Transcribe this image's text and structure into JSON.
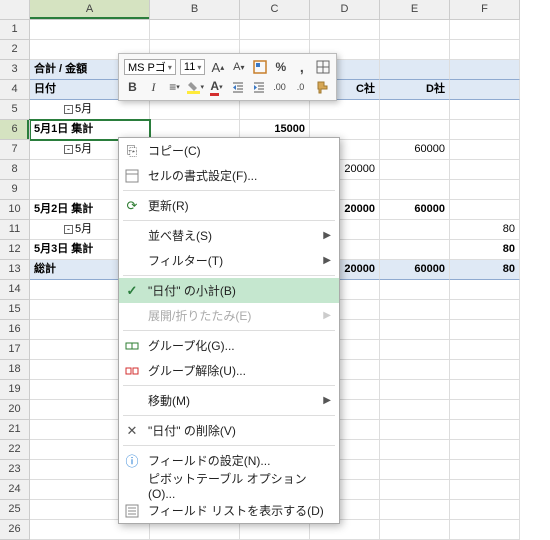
{
  "columns": [
    "A",
    "B",
    "C",
    "D",
    "E",
    "F"
  ],
  "rows": [
    "1",
    "2",
    "3",
    "4",
    "5",
    "6",
    "7",
    "8",
    "9",
    "10",
    "11",
    "12",
    "13",
    "14",
    "15",
    "16",
    "17",
    "18",
    "19",
    "20",
    "21",
    "22",
    "23",
    "24",
    "25",
    "26"
  ],
  "grid": {
    "r3A": "合計 / 金額",
    "r4A": "日付",
    "r4D": "C社",
    "r4E": "D社",
    "r5A": "5月",
    "r6A": "5月1日 集計",
    "r6C": "15000",
    "r7A": "5月",
    "r7E": "60000",
    "r8D": "20000",
    "r10A": "5月2日 集計",
    "r10D": "20000",
    "r10E": "60000",
    "r11A": "5月",
    "r11F": "80",
    "r12A": "5月3日 集計",
    "r12F": "80",
    "r13A": "総計",
    "r13D": "20000",
    "r13E": "60000",
    "r13F": "80"
  },
  "mini": {
    "font": "MS Pゴ",
    "size": "11",
    "grow": "A",
    "shrink": "A"
  },
  "ctx": {
    "copy": "コピー(C)",
    "format": "セルの書式設定(F)...",
    "refresh": "更新(R)",
    "sort": "並べ替え(S)",
    "filter": "フィルター(T)",
    "subtotal": "\"日付\" の小計(B)",
    "expand": "展開/折りたたみ(E)",
    "group": "グループ化(G)...",
    "ungroup": "グループ解除(U)...",
    "move": "移動(M)",
    "delete": "\"日付\" の削除(V)",
    "fieldset": "フィールドの設定(N)...",
    "pivotopt": "ピボットテーブル オプション(O)...",
    "fieldlist": "フィールド リストを表示する(D)"
  }
}
